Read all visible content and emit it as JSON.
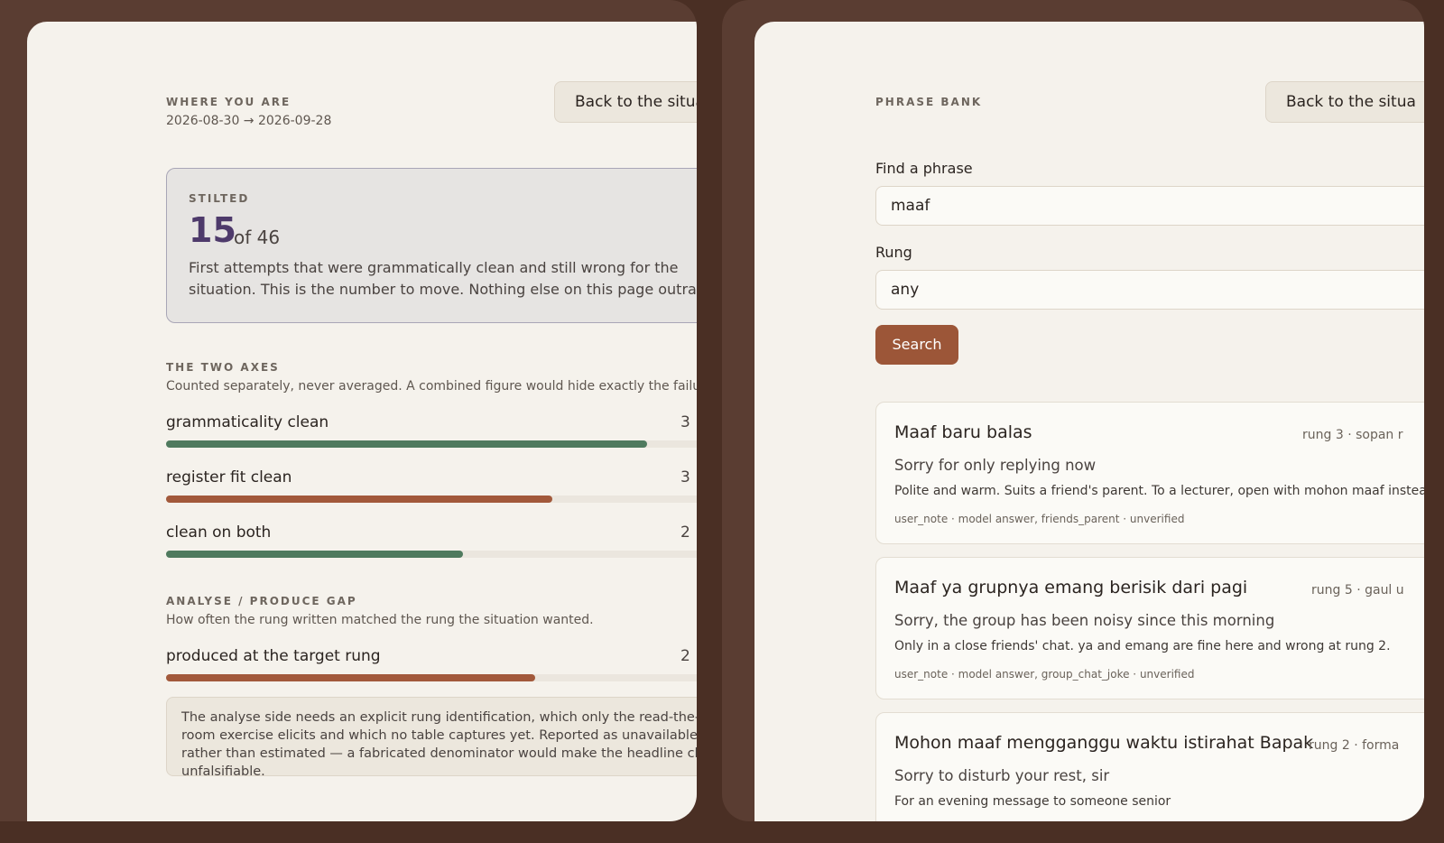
{
  "colors": {
    "background": "#4a2f24",
    "panel": "#f5f2ec",
    "accent_rust": "#a2593b",
    "accent_green": "#4f7a5e",
    "accent_purple": "#4e3a6b",
    "search_button": "#9c5638"
  },
  "left": {
    "eyebrow": "WHERE YOU ARE",
    "date_range": "2026-08-30 → 2026-09-28",
    "back_button": "Back to the situa",
    "stilted": {
      "label": "STILTED",
      "count": "15",
      "of_total": "of 46",
      "description": "First attempts that were grammatically clean and still wrong for the situation. This is the number to move. Nothing else on this page outrank"
    },
    "axes": {
      "title": "THE TWO AXES",
      "subtitle": "Counted separately, never averaged. A combined figure would hide exactly the failure a",
      "metrics": [
        {
          "label": "grammaticality clean",
          "value": "3",
          "fraction": 0.86,
          "color": "green"
        },
        {
          "label": "register fit clean",
          "value": "3",
          "fraction": 0.69,
          "color": "rust"
        },
        {
          "label": "clean on both",
          "value": "2",
          "fraction": 0.53,
          "color": "green"
        }
      ]
    },
    "gap": {
      "title": "ANALYSE / PRODUCE GAP",
      "subtitle": "How often the rung written matched the rung the situation wanted.",
      "metric": {
        "label": "produced at the target rung",
        "value": "2",
        "fraction": 0.66
      },
      "note": "The analyse side needs an explicit rung identification, which only the read-the-room exercise elicits and which no table captures yet. Reported as unavailable rather than estimated — a fabricated denominator would make the headline claim unfalsifiable."
    }
  },
  "right": {
    "eyebrow": "PHRASE BANK",
    "back_button": "Back to the situa",
    "find_label": "Find a phrase",
    "find_value": "maaf",
    "rung_label": "Rung",
    "rung_value": "any",
    "search_button": "Search",
    "results": [
      {
        "phrase": "Maaf baru balas",
        "meta": "rung 3 · sopan r",
        "translation": "Sorry for only replying now",
        "note": "Polite and warm. Suits a friend's parent. To a lecturer, open with mohon maaf instea",
        "source": "user_note · model answer, friends_parent · unverified"
      },
      {
        "phrase": "Maaf ya grupnya emang berisik dari pagi",
        "meta": "rung 5 · gaul u",
        "translation": "Sorry, the group has been noisy since this morning",
        "note": "Only in a close friends' chat. ya and emang are fine here and wrong at rung 2.",
        "source": "user_note · model answer, group_chat_joke · unverified"
      },
      {
        "phrase": "Mohon maaf mengganggu waktu istirahat Bapak",
        "meta": "rung 2 · forma",
        "translation": "Sorry to disturb your rest, sir",
        "note": "For an evening message to someone senior",
        "source": ""
      }
    ]
  }
}
